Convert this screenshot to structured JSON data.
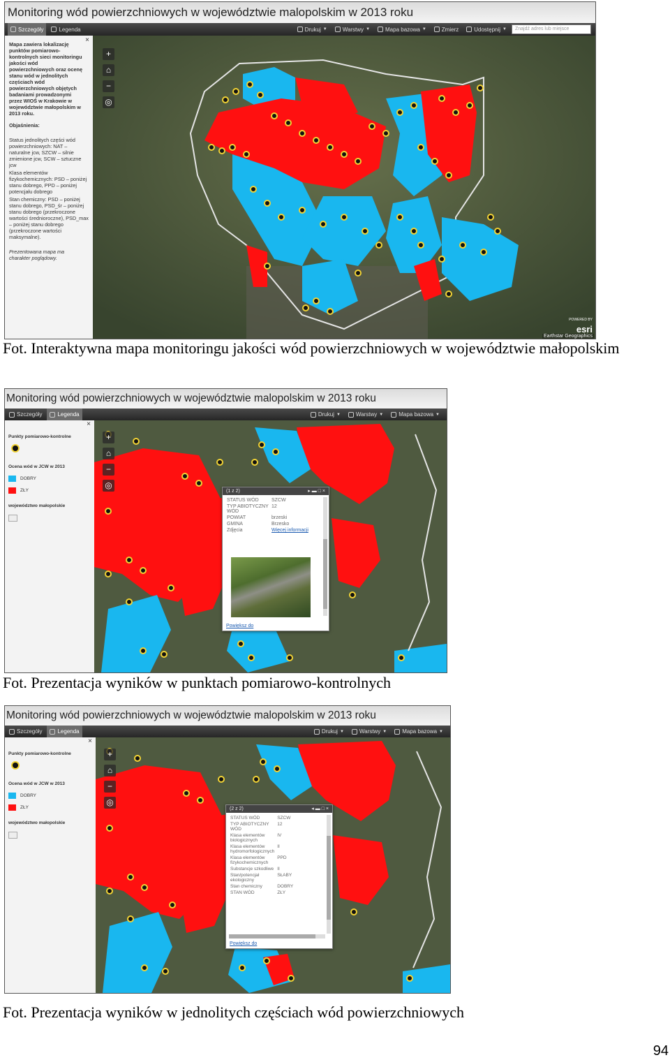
{
  "app_title": "Monitoring wód powierzchniowych w województwie malopolskim w 2013 roku",
  "toolbar": {
    "details": "Szczegóły",
    "legend": "Legenda",
    "print": "Drukuj",
    "layers": "Warstwy",
    "basemap": "Mapa bazowa",
    "measure": "Zmierz",
    "share": "Udostępnij",
    "search_placeholder": "Znajdź adres lub miejsce"
  },
  "screenshot1": {
    "details_text": "Mapa zawiera lokalizację punktów pomiarowo-kontrolnych sieci monitoringu jakości wód powierzchniowych oraz ocenę stanu wód w jednolitych częściach wód powierzchniowych objętych badaniami prowadzonymi przez WIOŚ w Krakowie w województwie małopolskim w 2013 roku.",
    "explanations_heading": "Objaśnienia:",
    "status_text": "Status jednolitych części wód powierzchniowych: NAT – naturalne jcw, SZCW – silnie zmienione jcw, SCW – sztuczne jcw",
    "physchem_text": "Klasa elementów fizykochemicznych: PSD – poniżej stanu dobrego, PPD – poniżej potencjału dobrego",
    "chemical_text": "Stan chemiczny: PSD – poniżej stanu dobrego, PSD_śr – poniżej stanu dobrego (przekroczone wartości średnioroczne), PSD_max – poniżej stanu dobrego (przekroczone wartości maksymalne).",
    "note": "Prezentowana mapa ma charakter poglądowy.",
    "attribution": "Earthstar Geographics",
    "esri": "esri",
    "powered_by": "POWERED BY"
  },
  "legend": {
    "points_heading": "Punkty pomiarowo-kontrolne",
    "assessment_heading": "Ocena wód w JCW w 2013",
    "good_label": "DOBRY",
    "bad_label": "ZŁY",
    "voivodeship_label": "województwo małopolskie"
  },
  "popup1": {
    "counter": "(1 z 2)",
    "rows": [
      {
        "k": "STATUS WÓD",
        "v": "SZCW"
      },
      {
        "k": "TYP ABIOTYCZNY WÓD",
        "v": "12"
      },
      {
        "k": "POWIAT",
        "v": "brzeski"
      },
      {
        "k": "GMINA",
        "v": "Brzesko"
      },
      {
        "k": "Zdjęcia",
        "v": "Więcej informacji"
      }
    ],
    "zoom_link": "Powiększ do"
  },
  "popup2": {
    "counter": "(2 z 2)",
    "rows": [
      {
        "k": "STATUS WÓD",
        "v": "SZCW"
      },
      {
        "k": "TYP ABIOTYCZNY WÓD",
        "v": "12"
      },
      {
        "k": "Klasa elementów biologicznych",
        "v": "IV"
      },
      {
        "k": "Klasa elementów hydromorfologicznych",
        "v": "II"
      },
      {
        "k": "Klasa elementów fizykochemicznych",
        "v": "PPD"
      },
      {
        "k": "Substancje szkodliwe",
        "v": "II"
      },
      {
        "k": "Stan/potencjał ekologiczny",
        "v": "SŁABY"
      },
      {
        "k": "Stan chemiczny",
        "v": "DOBRY"
      },
      {
        "k": "STAN WÓD",
        "v": "ZŁY"
      }
    ],
    "zoom_link": "Powiększ do"
  },
  "captions": {
    "c1": "Fot. Interaktywna mapa monitoringu jakości wód powierzchniowych w województwie małopolskim",
    "c2": "Fot. Prezentacja wyników w punktach pomiarowo-kontrolnych",
    "c3": "Fot. Prezentacja wyników w jednolitych częściach wód powierzchniowych"
  },
  "page_number": "94",
  "colors": {
    "bad": "#ff1010",
    "good": "#19b7ef",
    "satellite": "#4d5a3e",
    "point_fill": "#111111",
    "point_ring": "#f2d335"
  }
}
